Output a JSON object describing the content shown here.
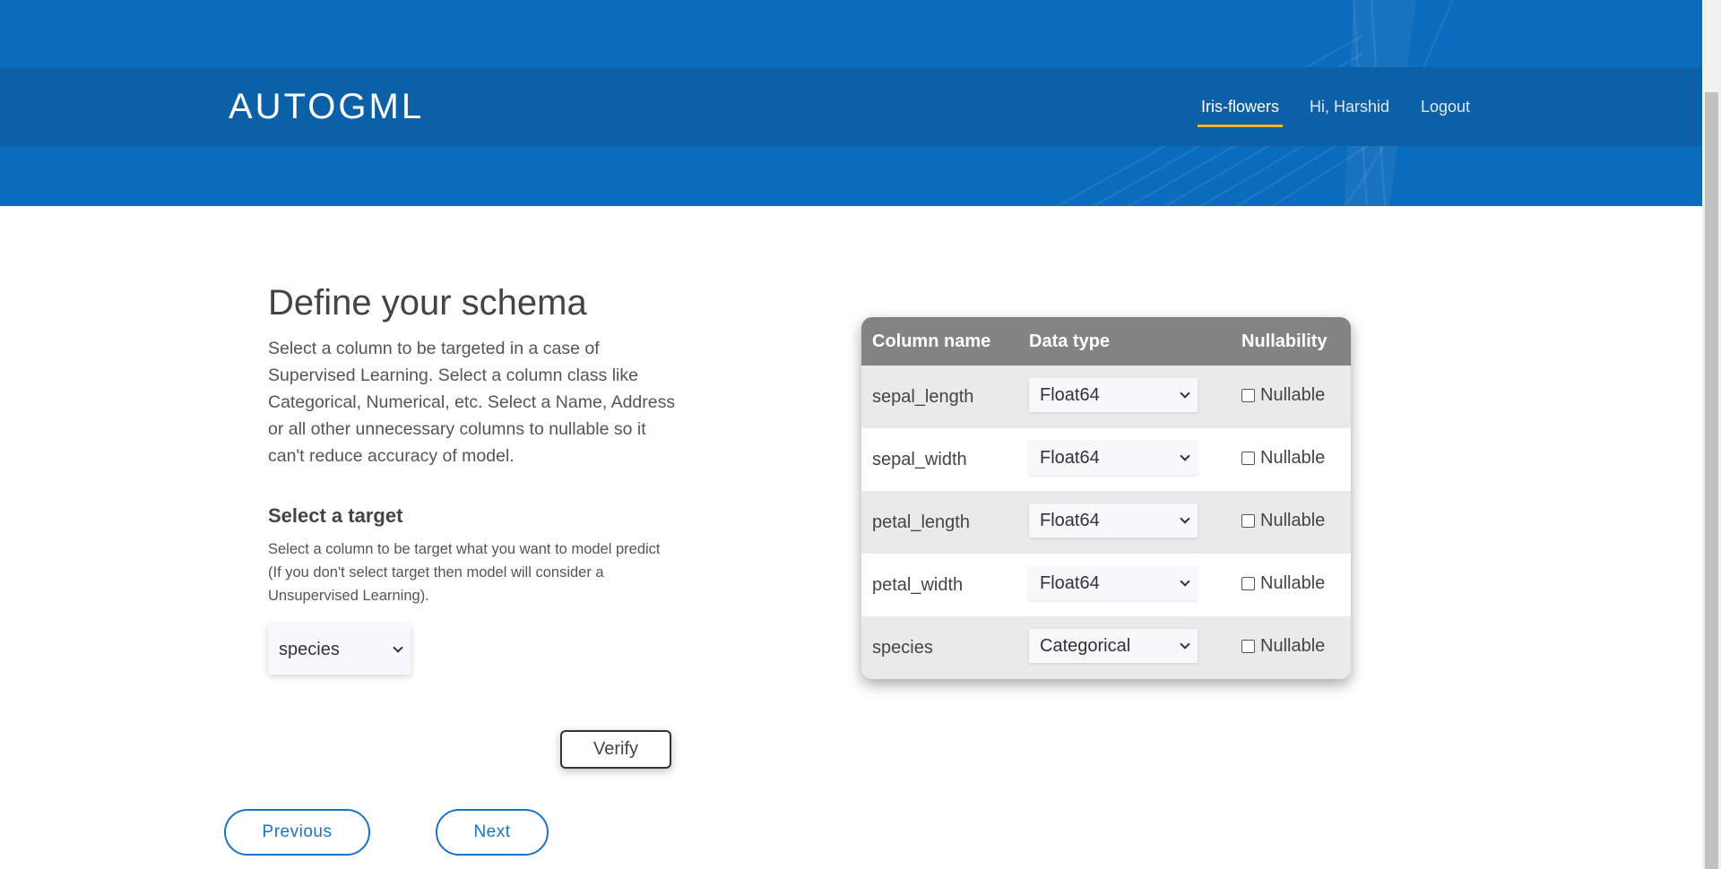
{
  "header": {
    "brand": "AUTOGML",
    "nav": [
      {
        "label": "Iris-flowers",
        "active": true
      },
      {
        "label": "Hi, Harshid",
        "active": false
      },
      {
        "label": "Logout",
        "active": false
      }
    ]
  },
  "colors": {
    "header_bg": "#0b6bbd",
    "navbar_bg": "#0c60a8",
    "accent": "#f2b52e",
    "button_blue": "#1a73c9"
  },
  "main": {
    "title": "Define your schema",
    "intro": "Select a column to be targeted in a case of Supervised Learning. Select a column class like Categorical, Numerical, etc. Select a Name, Address or all other unnecessary columns to nullable so it can't reduce accuracy of model.",
    "target": {
      "heading": "Select a target",
      "description": "Select a column to be target what you want to model predict (If you don't select target then model will consider a Unsupervised Learning).",
      "selected": "species"
    },
    "verify_label": "Verify",
    "previous_label": "Previous",
    "next_label": "Next"
  },
  "schema": {
    "headers": {
      "name": "Column name",
      "type": "Data type",
      "nullability": "Nullability"
    },
    "rows": [
      {
        "name": "sepal_length",
        "type": "Float64",
        "nullable_label": "Nullable",
        "nullable": false
      },
      {
        "name": "sepal_width",
        "type": "Float64",
        "nullable_label": "Nullable",
        "nullable": false
      },
      {
        "name": "petal_length",
        "type": "Float64",
        "nullable_label": "Nullable",
        "nullable": false
      },
      {
        "name": "petal_width",
        "type": "Float64",
        "nullable_label": "Nullable",
        "nullable": false
      },
      {
        "name": "species",
        "type": "Categorical",
        "nullable_label": "Nullable",
        "nullable": false
      }
    ]
  }
}
